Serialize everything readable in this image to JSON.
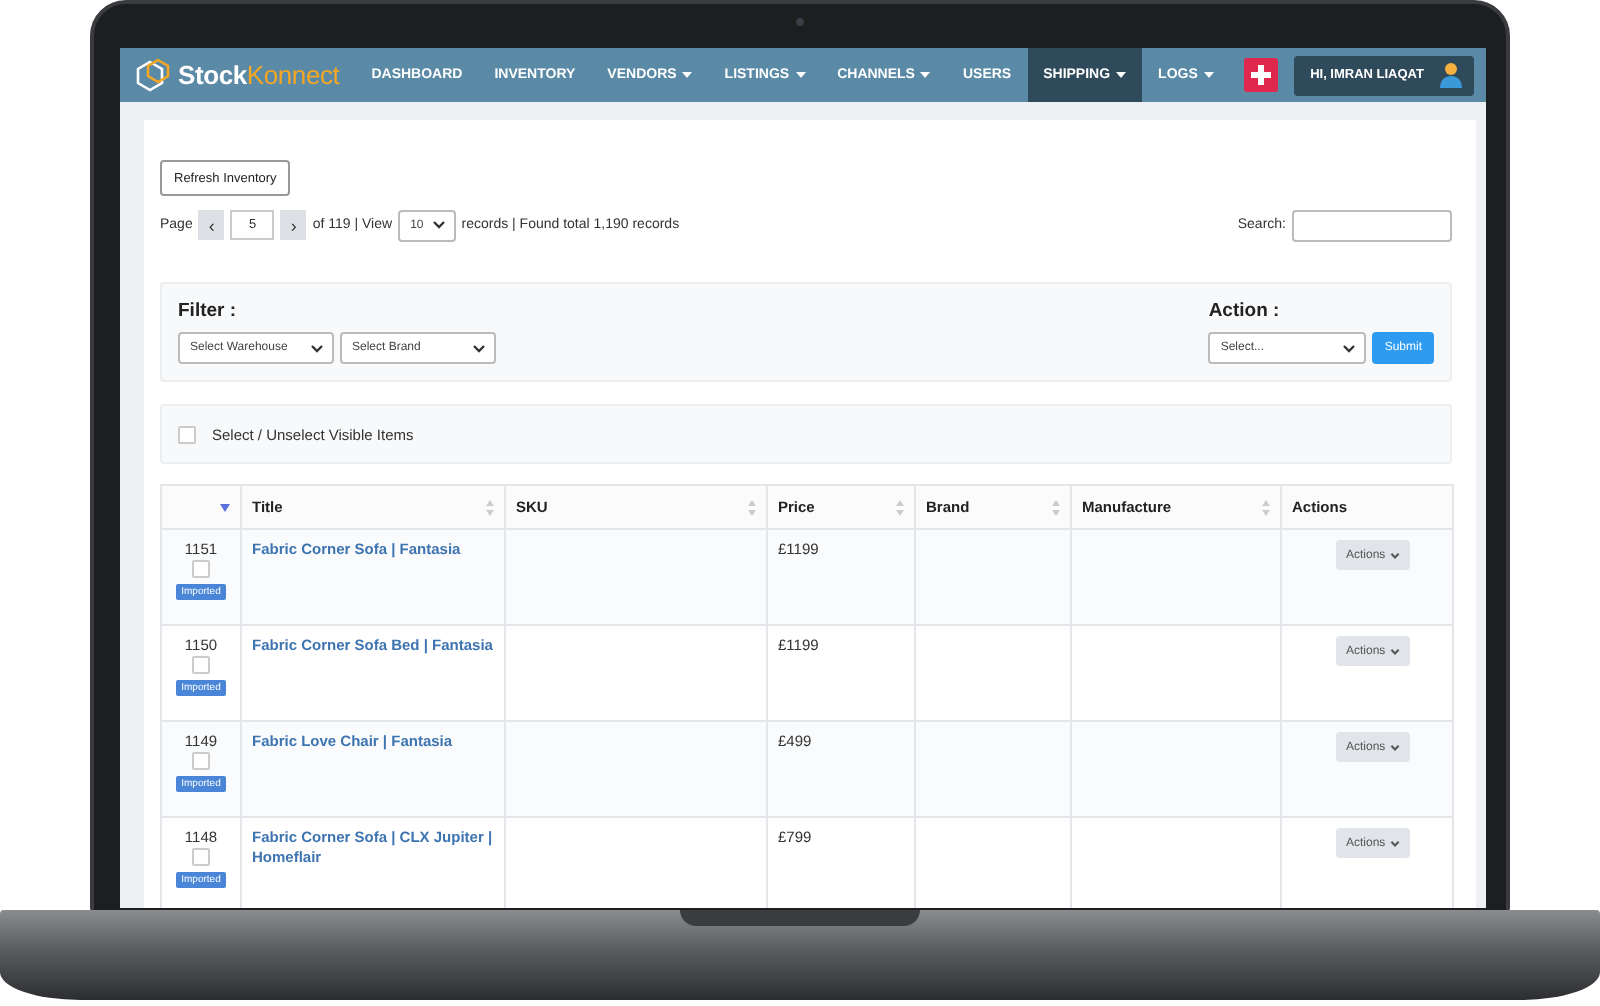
{
  "nav": {
    "logo": {
      "first": "Stock",
      "second": "Konnect"
    },
    "items": [
      {
        "label": "DASHBOARD",
        "dropdown": false,
        "selected": false
      },
      {
        "label": "INVENTORY",
        "dropdown": false,
        "selected": false
      },
      {
        "label": "VENDORS",
        "dropdown": true,
        "selected": false
      },
      {
        "label": "LISTINGS",
        "dropdown": true,
        "selected": false
      },
      {
        "label": "CHANNELS",
        "dropdown": true,
        "selected": false
      },
      {
        "label": "USERS",
        "dropdown": false,
        "selected": false
      },
      {
        "label": "SHIPPING",
        "dropdown": true,
        "selected": true
      },
      {
        "label": "LOGS",
        "dropdown": true,
        "selected": false
      }
    ],
    "user": "HI, IMRAN LIAQAT"
  },
  "toolbar": {
    "refresh_button": "Refresh Inventory",
    "page_label": "Page",
    "prev": "‹",
    "page": "5",
    "next": "›",
    "of_pages": "of 119 | View",
    "view": "10",
    "records": "records | Found total 1,190 records",
    "search_label": "Search:"
  },
  "filter": {
    "title": "Filter :",
    "selects": [
      "Select Warehouse",
      "Select Brand"
    ],
    "action_title": "Action :",
    "action_select": "Select...",
    "submit": "Submit"
  },
  "select_all": {
    "label": "Select / Unselect Visible Items",
    "checked": false
  },
  "table": {
    "columns": [
      {
        "kind": "descending"
      },
      {
        "label": "Title",
        "kind": "sortable"
      },
      {
        "label": "SKU",
        "kind": "sortable"
      },
      {
        "label": "Price",
        "kind": "sortable"
      },
      {
        "label": "Brand",
        "kind": "sortable"
      },
      {
        "label": "Manufacture",
        "kind": "sortable"
      },
      {
        "label": "Actions",
        "kind": "plain"
      }
    ],
    "rows": [
      {
        "id": "1151",
        "checked": false,
        "badge": "Imported",
        "title": "Fabric Corner Sofa | Fantasia",
        "price": "£1199",
        "action": "Actions"
      },
      {
        "id": "1150",
        "checked": false,
        "badge": "Imported",
        "title": "Fabric Corner Sofa Bed | Fantasia",
        "price": "£1199",
        "action": "Actions"
      },
      {
        "id": "1149",
        "checked": false,
        "badge": "Imported",
        "title": "Fabric Love Chair | Fantasia",
        "price": "£499",
        "action": "Actions"
      },
      {
        "id": "1148",
        "checked": false,
        "badge": "Imported",
        "title": "Fabric Corner Sofa | CLX Jupiter | Homeflair",
        "price": "£799",
        "action": "Actions"
      }
    ]
  }
}
